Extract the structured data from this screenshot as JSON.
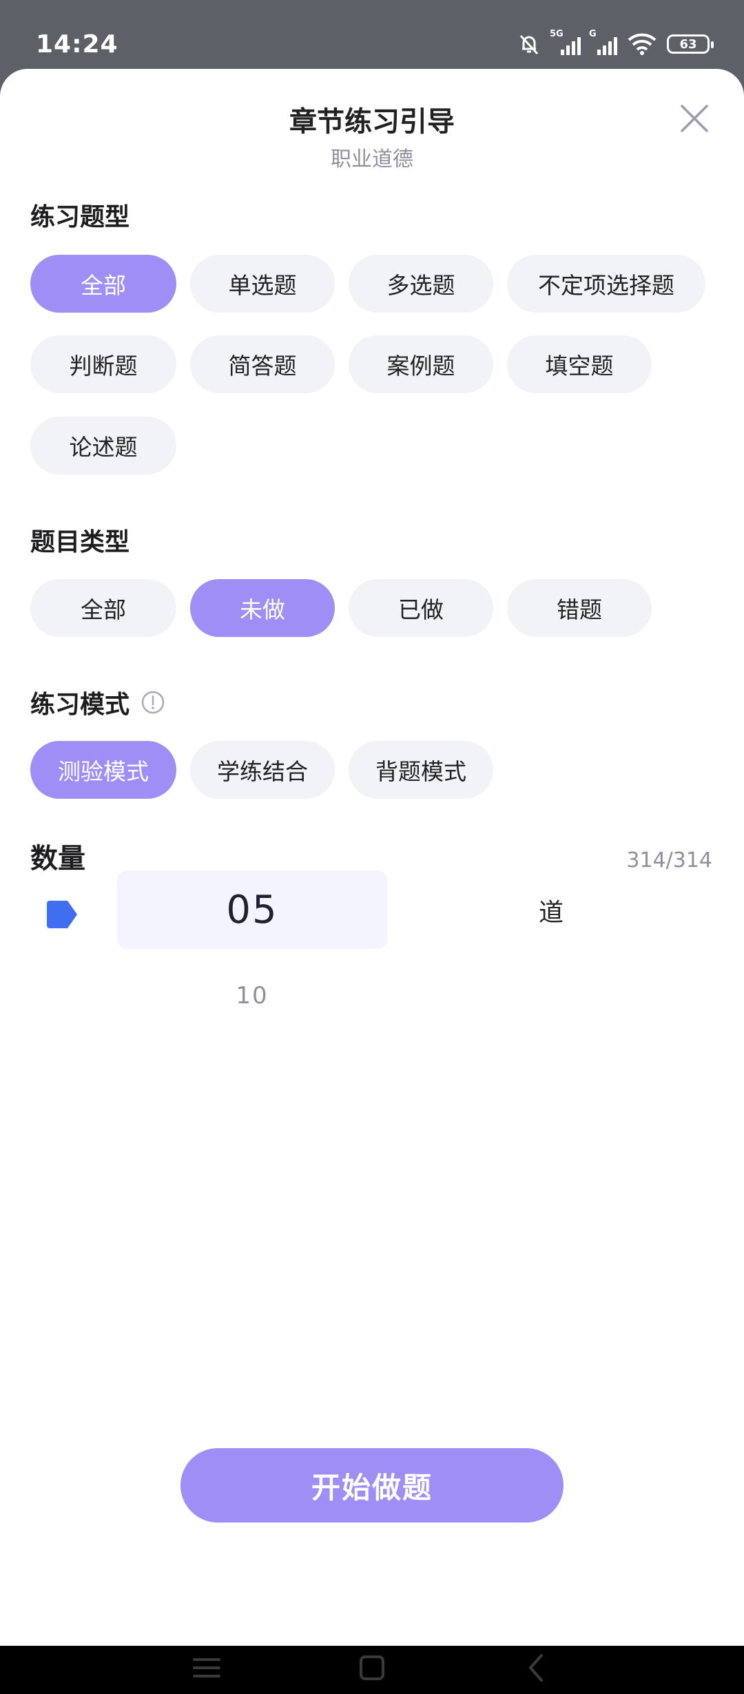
{
  "status": {
    "time": "14:24",
    "net1": "5G",
    "net2": "G",
    "battery": "63",
    "icons": [
      "mute-bell-icon",
      "signal-icon",
      "wifi-icon",
      "battery-icon"
    ]
  },
  "header": {
    "title": "章节练习引导",
    "subtitle": "职业道德",
    "close_icon": "close-icon"
  },
  "question_types": {
    "title": "练习题型",
    "options": [
      "全部",
      "单选题",
      "多选题",
      "不定项选择题",
      "判断题",
      "简答题",
      "案例题",
      "填空题",
      "论述题"
    ],
    "selected": "全部"
  },
  "item_types": {
    "title": "题目类型",
    "options": [
      "全部",
      "未做",
      "已做",
      "错题"
    ],
    "selected": "未做"
  },
  "practice_mode": {
    "title": "练习模式",
    "info_icon": "info-icon",
    "options": [
      "测验模式",
      "学练结合",
      "背题模式"
    ],
    "selected": "测验模式"
  },
  "quantity": {
    "title": "数量",
    "count": "314/314",
    "picker_current": "05",
    "picker_next": "10",
    "unit": "道"
  },
  "start_button": "开始做题",
  "colors": {
    "accent": "#9f8ef5",
    "chip_bg": "#f2f3f7",
    "tag_blue": "#3f6ff0"
  }
}
